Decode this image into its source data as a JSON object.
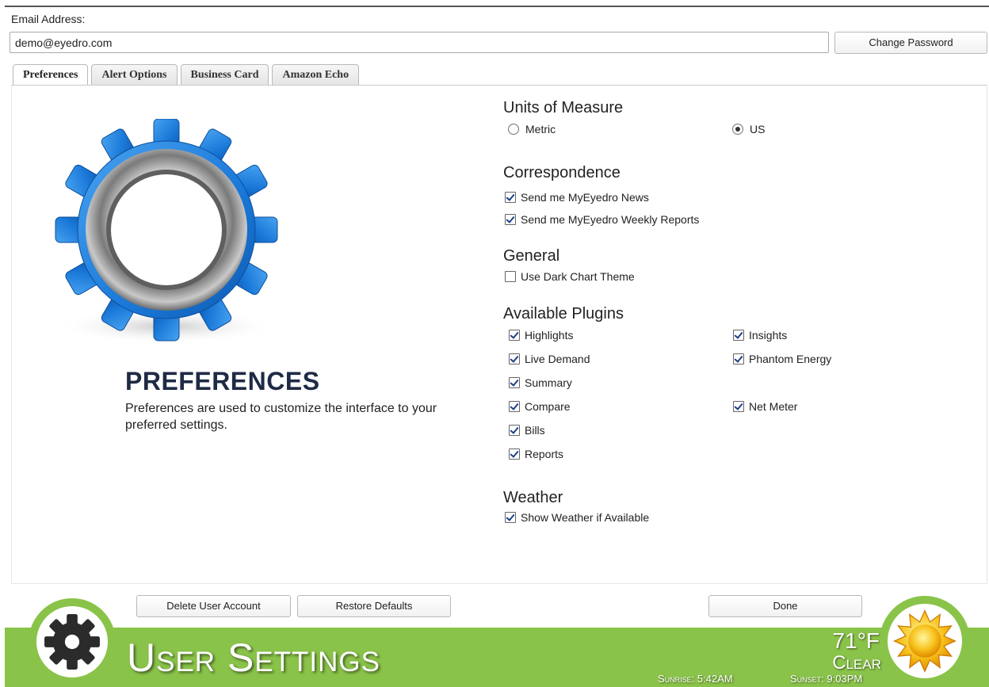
{
  "account": {
    "email_label": "Email Address:",
    "email_value": "demo@eyedro.com",
    "change_password_label": "Change Password"
  },
  "tabs": [
    {
      "label": "Preferences",
      "active": true
    },
    {
      "label": "Alert Options",
      "active": false
    },
    {
      "label": "Business Card",
      "active": false
    },
    {
      "label": "Amazon Echo",
      "active": false
    }
  ],
  "intro": {
    "title": "PREFERENCES",
    "description": "Preferences are used to customize the interface to your preferred settings."
  },
  "units": {
    "title": "Units of Measure",
    "options": [
      {
        "label": "Metric",
        "selected": false
      },
      {
        "label": "US",
        "selected": true
      }
    ]
  },
  "correspondence": {
    "title": "Correspondence",
    "options": [
      {
        "label": "Send me MyEyedro News",
        "checked": true
      },
      {
        "label": "Send me MyEyedro Weekly Reports",
        "checked": true
      }
    ]
  },
  "general": {
    "title": "General",
    "options": [
      {
        "label": "Use Dark Chart Theme",
        "checked": false
      }
    ]
  },
  "plugins": {
    "title": "Available Plugins",
    "options": [
      {
        "label": "Highlights",
        "checked": true
      },
      {
        "label": "Insights",
        "checked": true
      },
      {
        "label": "Live Demand",
        "checked": true
      },
      {
        "label": "Phantom Energy",
        "checked": true
      },
      {
        "label": "Summary",
        "checked": true
      },
      {
        "label": "Compare",
        "checked": true
      },
      {
        "label": "Net Meter",
        "checked": true
      },
      {
        "label": "Bills",
        "checked": true
      },
      {
        "label": "Reports",
        "checked": true
      }
    ]
  },
  "weather_section": {
    "title": "Weather",
    "options": [
      {
        "label": "Show Weather if Available",
        "checked": true
      }
    ]
  },
  "actions": {
    "delete_label": "Delete User Account",
    "restore_label": "Restore Defaults",
    "done_label": "Done"
  },
  "footer": {
    "title": "User Settings",
    "temperature": "71°F",
    "condition": "Clear",
    "sunrise": "Sunrise: 5:42AM",
    "sunset": "Sunset: 9:03PM",
    "accent_color": "#8ac349"
  },
  "icons": [
    "gear-icon",
    "settings-gear-icon",
    "sun-icon"
  ]
}
